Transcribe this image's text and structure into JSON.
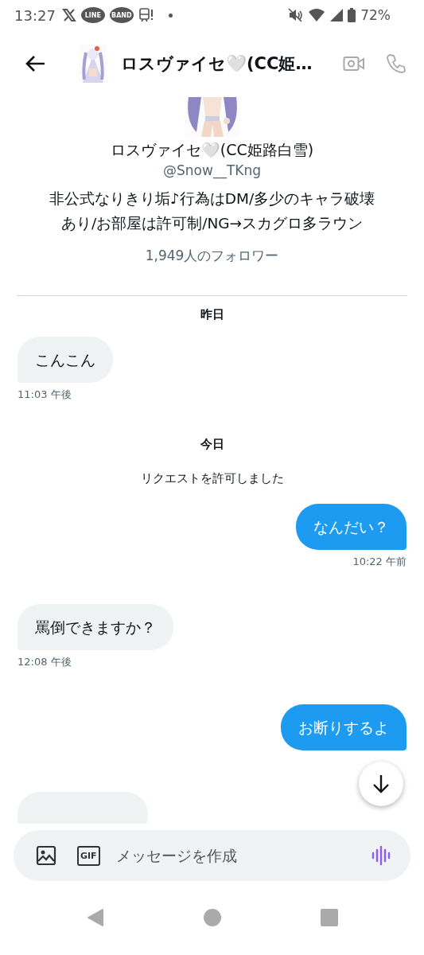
{
  "status_bar": {
    "time": "13:27",
    "notifications": [
      {
        "kind": "x"
      },
      {
        "kind": "line",
        "label": "LINE"
      },
      {
        "kind": "band",
        "label": "BAND"
      },
      {
        "kind": "train"
      },
      {
        "kind": "dot"
      }
    ],
    "battery": "72%"
  },
  "header": {
    "title": "ロスヴァイセ🤍(CC姫…"
  },
  "profile": {
    "name": "ロスヴァイセ🤍(CC姫路白雪)",
    "handle": "@Snow__TKng",
    "bio": "非公式なりきり垢♪行為はDM/多少のキャラ破壊あり/お部屋は許可制/NG→スカグロ多ラウン",
    "followers": "1,949人のフォロワー"
  },
  "messages": [
    {
      "kind": "date",
      "text": "昨日"
    },
    {
      "kind": "received",
      "text": "こんこん",
      "time": "11:03 午後"
    },
    {
      "kind": "date",
      "text": "今日"
    },
    {
      "kind": "system",
      "text": "リクエストを許可しました"
    },
    {
      "kind": "sent",
      "text": "なんだい？",
      "time": "10:22 午前"
    },
    {
      "kind": "received",
      "text": "罵倒できますか？",
      "time": "12:08 午後"
    },
    {
      "kind": "sent",
      "text": "お断りするよ"
    },
    {
      "kind": "received-cut"
    }
  ],
  "composer": {
    "gif_label": "GIF",
    "placeholder": "メッセージを作成"
  }
}
